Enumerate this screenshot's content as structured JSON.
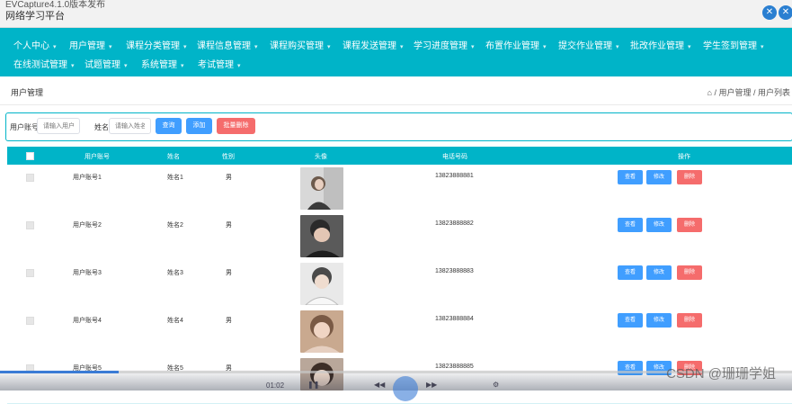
{
  "window": {
    "title": "EVCapture4.1.0版本发布",
    "app_name": "网络学习平台"
  },
  "topbar": {
    "expand_icon": "expand-icon",
    "close_icon": "close-icon"
  },
  "nav": {
    "items": [
      {
        "label": "个人中心"
      },
      {
        "label": "用户管理"
      },
      {
        "label": "课程分类管理"
      },
      {
        "label": "课程信息管理"
      },
      {
        "label": "课程购买管理"
      },
      {
        "label": "课程发送管理"
      },
      {
        "label": "学习进度管理"
      },
      {
        "label": "布置作业管理"
      },
      {
        "label": "提交作业管理"
      },
      {
        "label": "批改作业管理"
      },
      {
        "label": "学生签到管理"
      },
      {
        "label": "在线测试管理"
      },
      {
        "label": "试题管理"
      },
      {
        "label": "系统管理"
      },
      {
        "label": "考试管理"
      }
    ],
    "caret": "▾"
  },
  "breadcrumb": {
    "title": "用户管理",
    "home_icon": "⌂",
    "path": "/ 用户管理 / 用户列表"
  },
  "search": {
    "account_label": "用户账号",
    "account_placeholder": "请输入用户账号",
    "name_label": "姓名",
    "name_placeholder": "请输入姓名",
    "search_button": "查询",
    "add_button": "添加",
    "batch_delete_button": "批量删除"
  },
  "table": {
    "headers": {
      "account": "用户账号",
      "name": "姓名",
      "gender": "性别",
      "avatar": "头像",
      "phone": "电话号码",
      "actions": "操作"
    },
    "rows": [
      {
        "account": "用户账号1",
        "name": "姓名1",
        "gender": "男",
        "phone": "13823888881"
      },
      {
        "account": "用户账号2",
        "name": "姓名2",
        "gender": "男",
        "phone": "13823888882"
      },
      {
        "account": "用户账号3",
        "name": "姓名3",
        "gender": "男",
        "phone": "13823888883"
      },
      {
        "account": "用户账号4",
        "name": "姓名4",
        "gender": "男",
        "phone": "13823888884"
      },
      {
        "account": "用户账号5",
        "name": "姓名5",
        "gender": "男",
        "phone": "13823888885"
      }
    ],
    "row_actions": {
      "view": "查看",
      "edit": "修改",
      "delete": "删除"
    }
  },
  "video": {
    "time": "01:02",
    "watermark": "CSDN @珊珊学姐",
    "play_icon": "play-icon"
  },
  "colors": {
    "primary": "#00b4c8",
    "button_blue": "#409eff",
    "button_red": "#f56c6c"
  }
}
